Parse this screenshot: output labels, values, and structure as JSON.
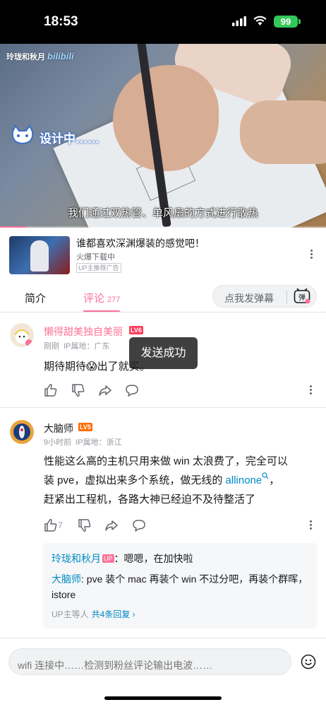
{
  "status": {
    "time": "18:53",
    "battery": "99"
  },
  "video": {
    "watermark": "玲珑和秋月",
    "watermark_logo": "bilibili",
    "overlay_text": "设计中……",
    "subtitle": "我们通过双热管、单风扇的方式进行散热",
    "progress_fraction": 0.08
  },
  "ad": {
    "title": "谁都喜欢深渊爆装的感觉吧！",
    "sub": "火爆下载中",
    "tag": "UP主推荐广告"
  },
  "tabs": {
    "intro": "简介",
    "comments": "评论",
    "comment_count": "277",
    "danmaku_placeholder": "点我发弹幕",
    "danmaku_icon_label": "弹"
  },
  "comments": [
    {
      "name": "懒得甜美独自美丽",
      "level": "LV6",
      "time": "刚刚",
      "ip": "IP属地：广东",
      "text": "期待期待😱出了就买。",
      "likes": ""
    },
    {
      "name": "大脑师",
      "level": "LV5",
      "time": "9小时前",
      "ip": "IP属地：浙江",
      "text_line1": "性能这么高的主机只用来做 win 太浪费了，完全可以",
      "text_line2_pre": "装 pve，虚拟出来多个系统，做无线的 ",
      "text_link": "allinone",
      "text_line2_post": "，",
      "text_line3": "赶紧出工程机，各路大神已经迫不及待整活了",
      "likes": "7"
    }
  ],
  "replies": {
    "r1_name": "玲珑和秋月",
    "r1_badge": "UP",
    "r1_text": "：嗯嗯，在加快啦",
    "r2_name": "大脑师",
    "r2_text": ": pve 装个 mac 再装个 win 不过分吧，再装个群晖，istore",
    "foot_pre": "UP主等人",
    "foot_link": "共4条回复 ›"
  },
  "toast": "发送成功",
  "bottom": {
    "placeholder": "wifi 连接中……检测到粉丝评论输出电波……"
  },
  "colors": {
    "accent": "#fb7299",
    "link": "#008ac5",
    "level": "#ff6c00"
  }
}
